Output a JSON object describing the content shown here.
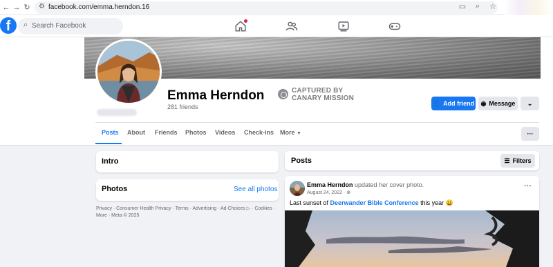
{
  "browser": {
    "url": "facebook.com/emma.herndon.16"
  },
  "header": {
    "search_placeholder": "Search Facebook"
  },
  "profile": {
    "name": "Emma Herndon",
    "friends": "281 friends",
    "stamp_line1": "CAPTURED BY",
    "stamp_line2": "CANARY MISSION",
    "add_friend": "Add friend",
    "message": "Message"
  },
  "tabs": {
    "posts": "Posts",
    "about": "About",
    "friends": "Friends",
    "photos": "Photos",
    "videos": "Videos",
    "checkins": "Check-ins",
    "more": "More"
  },
  "more_icon_glyph": "···",
  "left": {
    "intro_title": "Intro",
    "photos_title": "Photos",
    "see_all_photos": "See all photos",
    "footer": "Privacy · Consumer Health Privacy · Terms · Advertising · Ad Choices ▷ · Cookies · More · Meta © 2025"
  },
  "posts": {
    "title": "Posts",
    "filters": "Filters",
    "post": {
      "author": "Emma Herndon",
      "action": "updated her cover photo.",
      "date": "August 24, 2022 · ",
      "text_before": "Last sunset of ",
      "link": "Deerwander Bible Conference",
      "text_after": " this year 😀"
    }
  },
  "colors": {
    "brand": "#1877f2",
    "page_bg": "#f0f2f5",
    "notification": "#e41e3f"
  }
}
